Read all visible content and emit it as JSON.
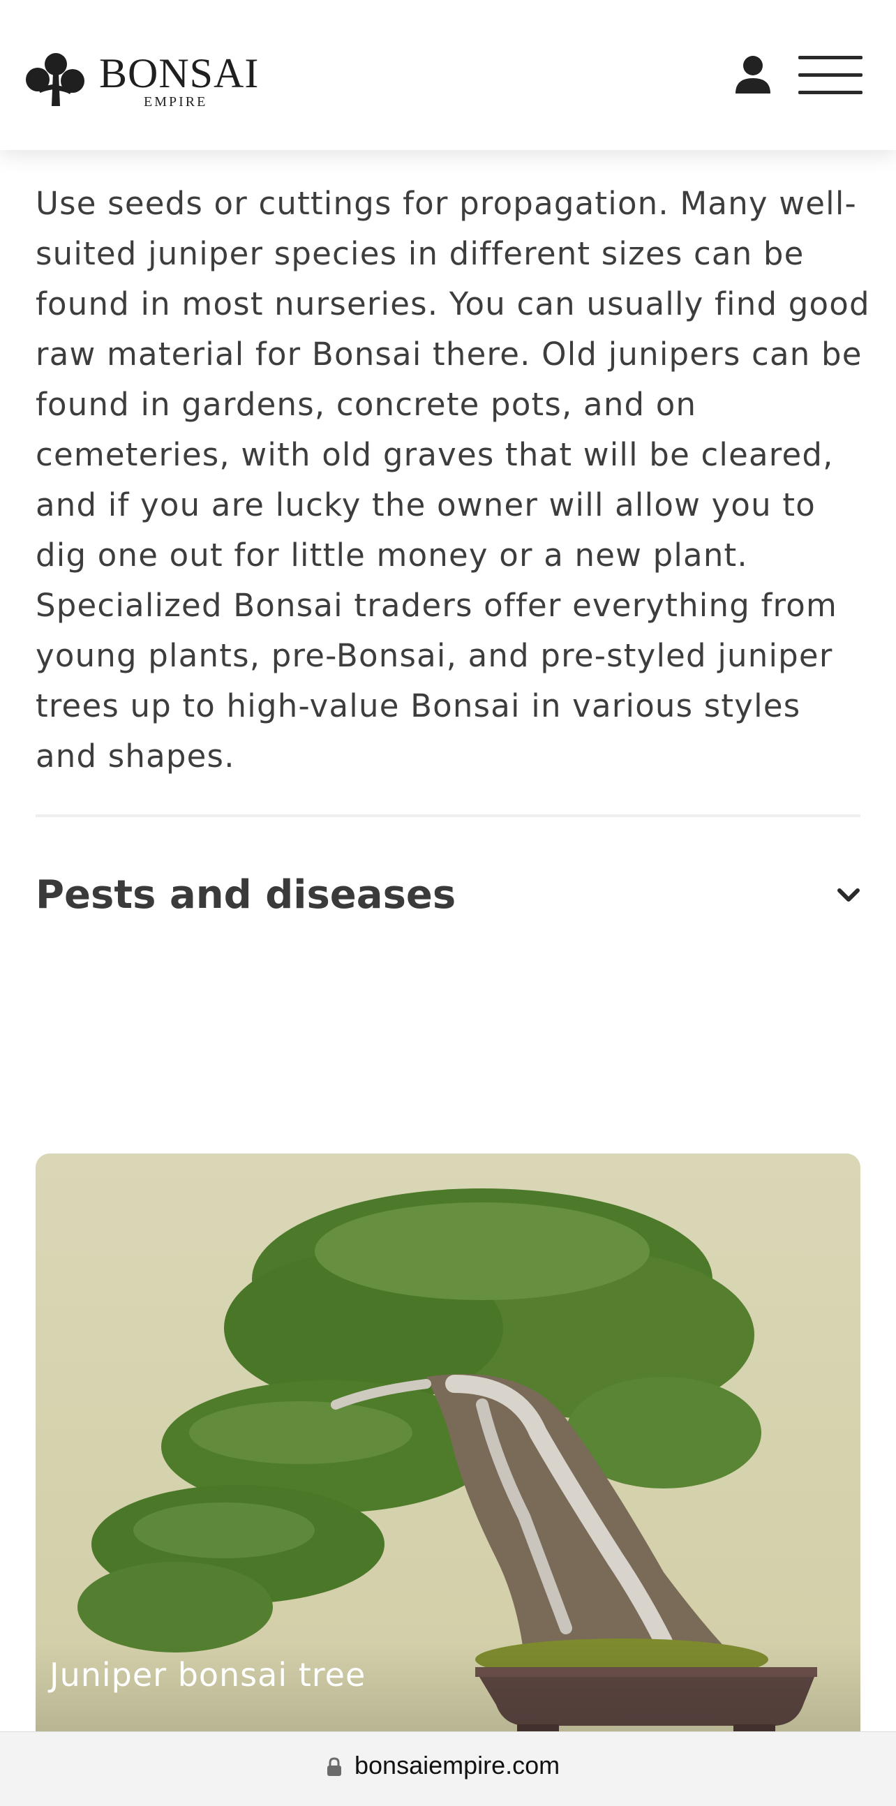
{
  "header": {
    "logo_title": "BONSAI",
    "logo_subtitle": "EMPIRE",
    "icons": {
      "logo": "bonsai-tree-logo-icon",
      "account": "user-icon",
      "menu": "hamburger-menu-icon"
    }
  },
  "content": {
    "paragraph": "Use seeds or cuttings for propagation. Many well-suited juniper species in different sizes can be found in most nurseries. You can usually find good raw material for Bonsai there. Old junipers can be found in gardens, concrete pots, and on cemeteries, with old graves that will be cleared, and if you are lucky the owner will allow you to dig one out for little money or a new plant. Specialized Bonsai traders offer everything from young plants, pre-Bonsai, and pre-styled juniper trees up to high-value Bonsai in various styles and shapes.",
    "accordion": {
      "title": "Pests and diseases",
      "state": "collapsed",
      "icon": "chevron-down-icon"
    },
    "image_card": {
      "caption": "Juniper bonsai tree"
    }
  },
  "browser": {
    "url": "bonsaiempire.com",
    "icon": "lock-icon"
  },
  "colors": {
    "text": "#3d3d3d",
    "heading": "#3a3a3a",
    "header_bg": "#ffffff",
    "url_bar_bg": "#f3f3f3",
    "photo_background": "#d6d3ae"
  }
}
